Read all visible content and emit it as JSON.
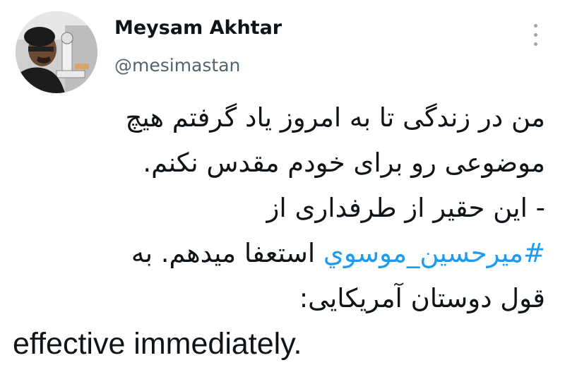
{
  "author": {
    "display_name": "Meysam Akhtar",
    "handle": "@mesimastan",
    "avatar_icon": "profile-photo"
  },
  "menu": {
    "icon": "more-vertical-icon"
  },
  "tweet": {
    "line1": "من در زندگی تا به امروز یاد گرفتم هیچ",
    "line2": "موضوعی رو برای خودم مقدس نکنم.",
    "line3": "- این حقیر از طرفداری از",
    "line4_hashtag": "#میرحسین_موسوي",
    "line4_rest": " استعفا میدهم. به",
    "line5": "قول دوستان آمریکایی:",
    "line6": "effective immediately."
  },
  "colors": {
    "text": "#0f1419",
    "secondary": "#536471",
    "hashtag": "#1d9bf0",
    "background": "#ffffff"
  }
}
